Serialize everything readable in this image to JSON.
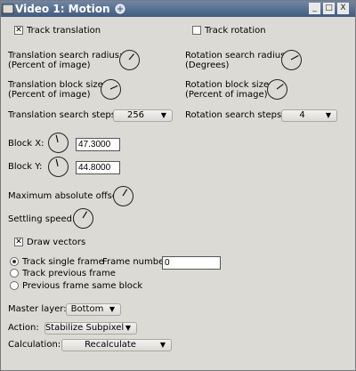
{
  "window": {
    "title": "Video 1: Motion",
    "buttons": {
      "minimize": "_",
      "maximize": "□",
      "close": "X"
    }
  },
  "track_translation": {
    "label": "Track translation",
    "checked": true
  },
  "track_rotation": {
    "label": "Track rotation",
    "checked": false
  },
  "translation_search_radius": {
    "line1": "Translation search radius:",
    "line2": "(Percent of image)"
  },
  "rotation_search_radius": {
    "line1": "Rotation search radius:",
    "line2": "(Degrees)"
  },
  "translation_block_size": {
    "line1": "Translation block size:",
    "line2": "(Percent of image)"
  },
  "rotation_block_size": {
    "line1": "Rotation block size:",
    "line2": "(Percent of image)"
  },
  "translation_search_steps": {
    "label": "Translation search steps:",
    "value": "256"
  },
  "rotation_search_steps": {
    "label": "Rotation search steps:",
    "value": "4"
  },
  "block_x": {
    "label": "Block X:",
    "value": "47.3000"
  },
  "block_y": {
    "label": "Block Y:",
    "value": "44.8000"
  },
  "maximum_absolute_offset": {
    "label": "Maximum absolute offset:"
  },
  "settling_speed": {
    "label": "Settling speed:"
  },
  "draw_vectors": {
    "label": "Draw vectors",
    "checked": true
  },
  "tracking_mode": {
    "options": [
      "Track single frame",
      "Track previous frame",
      "Previous frame same block"
    ],
    "selected": "Track single frame"
  },
  "frame_number": {
    "label": "Frame number:",
    "value": "0"
  },
  "master_layer": {
    "label": "Master layer:",
    "value": "Bottom"
  },
  "action": {
    "label": "Action:",
    "value": "Stabilize Subpixel"
  },
  "calculation": {
    "label": "Calculation:",
    "value": "Recalculate"
  },
  "icons": {
    "check": "✕",
    "dropdown": "▼"
  }
}
